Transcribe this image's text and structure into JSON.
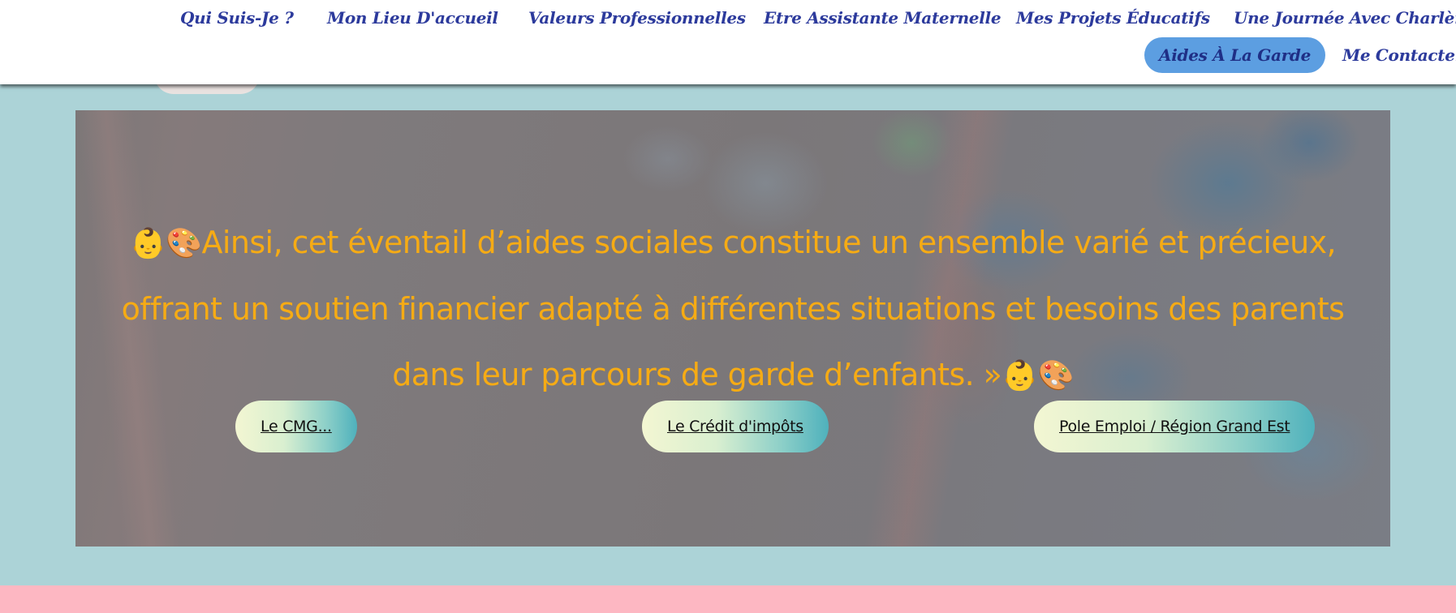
{
  "nav": {
    "items": [
      {
        "label": "Qui Suis-Je ?",
        "active": false
      },
      {
        "label": "Mon Lieu D'accueil",
        "active": false
      },
      {
        "label": "Valeurs Professionnelles",
        "active": false
      },
      {
        "label": "Etre Assistante Maternelle",
        "active": false
      },
      {
        "label": "Mes Projets Éducatifs",
        "active": false
      },
      {
        "label": "Une Journée Avec Charlène",
        "active": false
      },
      {
        "label": "Aides À La Garde",
        "active": true
      },
      {
        "label": "Me Contacter",
        "active": false
      }
    ]
  },
  "hero": {
    "quote_line1": "Ainsi, cet éventail d’aides sociales constitue un ensemble varié et précieux,",
    "quote_line2": "offrant un soutien financier adapté à différentes situations et besoins des parents",
    "quote_line3": "dans leur parcours de garde d’enfants. »",
    "emoji_baby": "👶",
    "emoji_palette": "🎨",
    "buttons": [
      {
        "label": "Le CMG..."
      },
      {
        "label": "Le Crédit d'impôts"
      },
      {
        "label": "Pole Emploi / Région Grand Est"
      }
    ]
  },
  "colors": {
    "page_background": "#acd3d7",
    "nav_text": "#2c3a9c",
    "nav_active_background": "#5c9ee1",
    "quote_text": "#f6ab14",
    "footer_band": "#fdb7c2"
  }
}
